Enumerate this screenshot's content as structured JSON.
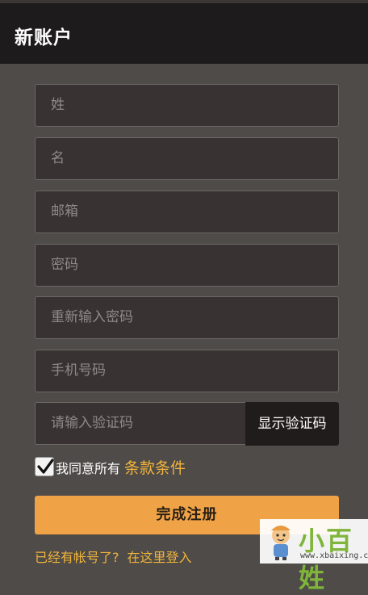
{
  "header": {
    "title": "新账户"
  },
  "form": {
    "fields": [
      {
        "placeholder": "姓"
      },
      {
        "placeholder": "名"
      },
      {
        "placeholder": "邮箱"
      },
      {
        "placeholder": "密码"
      },
      {
        "placeholder": "重新输入密码"
      },
      {
        "placeholder": "手机号码"
      },
      {
        "placeholder": "请输入验证码"
      }
    ],
    "captcha_button": "显示验证码",
    "agree_checked": true,
    "agree_text": "我同意所有",
    "terms_link": "条款条件",
    "submit_label": "完成注册",
    "login_prompt": "已经有帐号了?",
    "login_link": "在这里登入"
  },
  "watermark": {
    "logo_text": "小百姓",
    "url": "www.xbaixing.com"
  },
  "colors": {
    "background": "#4f4b49",
    "header": "#1d1b1b",
    "accent": "#f0a346",
    "link": "#f0b43a"
  }
}
